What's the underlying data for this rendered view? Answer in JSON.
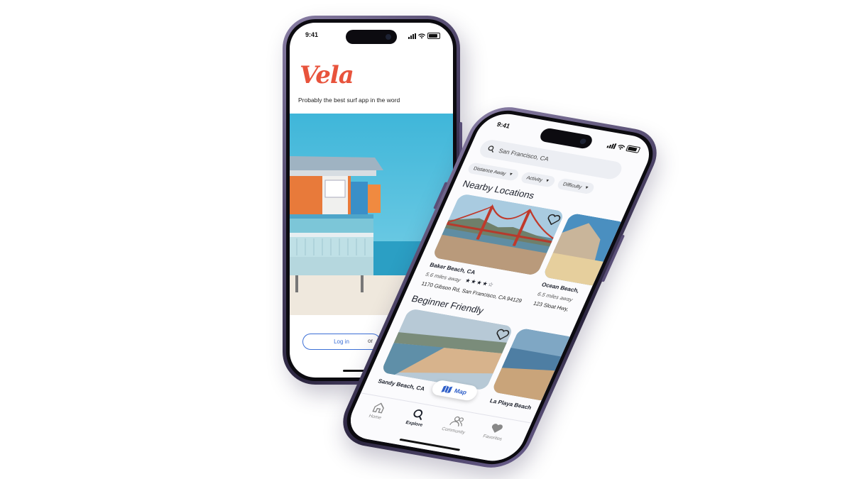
{
  "login_screen": {
    "status_time": "9:41",
    "logo": "Vela",
    "tagline": "Probably the best surf app in the word",
    "login_label": "Log in",
    "or_label": "or"
  },
  "explore_screen": {
    "status_time": "9:41",
    "search_value": "San Francisco, CA",
    "filters": [
      {
        "label": "Distance Away"
      },
      {
        "label": "Activity"
      },
      {
        "label": "Difficulty"
      }
    ],
    "sections": {
      "nearby_title": "Nearby Locations",
      "beginner_title": "Beginner Friendly"
    },
    "nearby_cards": [
      {
        "name": "Baker Beach, CA",
        "distance": "5.6 miles away",
        "rating": 4,
        "rating_stars": "★★★★☆",
        "address": "1170 Gibson Rd, San Francisco, CA 94129"
      },
      {
        "name": "Ocean Beach,",
        "distance": "6.5 miles away",
        "address": "123 Sloat Hwy,"
      }
    ],
    "beginner_cards": [
      {
        "name": "Sandy Beach, CA"
      },
      {
        "name": "La Playa Beach"
      }
    ],
    "map_label": "Map",
    "tabs": [
      {
        "label": "Home",
        "icon": "home-icon"
      },
      {
        "label": "Explore",
        "icon": "search-icon",
        "active": true
      },
      {
        "label": "Community",
        "icon": "people-icon"
      },
      {
        "label": "Favorites",
        "icon": "heart-icon"
      }
    ],
    "accent_color": "#2f5fc8",
    "brand_color": "#e8533c"
  }
}
